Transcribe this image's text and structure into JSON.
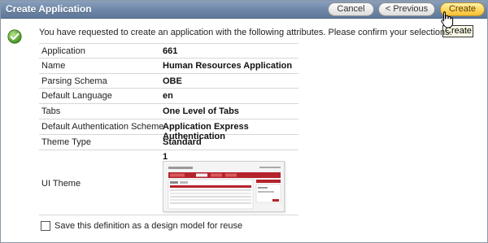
{
  "window": {
    "title": "Create Application"
  },
  "toolbar": {
    "cancel_label": "Cancel",
    "previous_label": "< Previous",
    "create_label": "Create",
    "create_tooltip": "Create"
  },
  "message": "You have requested to create an application with the following attributes. Please confirm your selections.",
  "attributes": [
    {
      "label": "Application",
      "value": "661"
    },
    {
      "label": "Name",
      "value": "Human Resources Application"
    },
    {
      "label": "Parsing Schema",
      "value": "OBE"
    },
    {
      "label": "Default Language",
      "value": "en"
    },
    {
      "label": "Tabs",
      "value": "One Level of Tabs"
    },
    {
      "label": "Default Authentication Scheme",
      "value": "Application Express Authentication"
    },
    {
      "label": "Theme Type",
      "value": "Standard"
    }
  ],
  "ui_theme": {
    "label": "UI Theme",
    "value": "1"
  },
  "reuse_option": {
    "label": "Save this definition as a design model for reuse",
    "checked": false
  },
  "colors": {
    "header": "#6d86a8",
    "create_button": "#ffd35a",
    "theme_accent": "#b4232b"
  }
}
